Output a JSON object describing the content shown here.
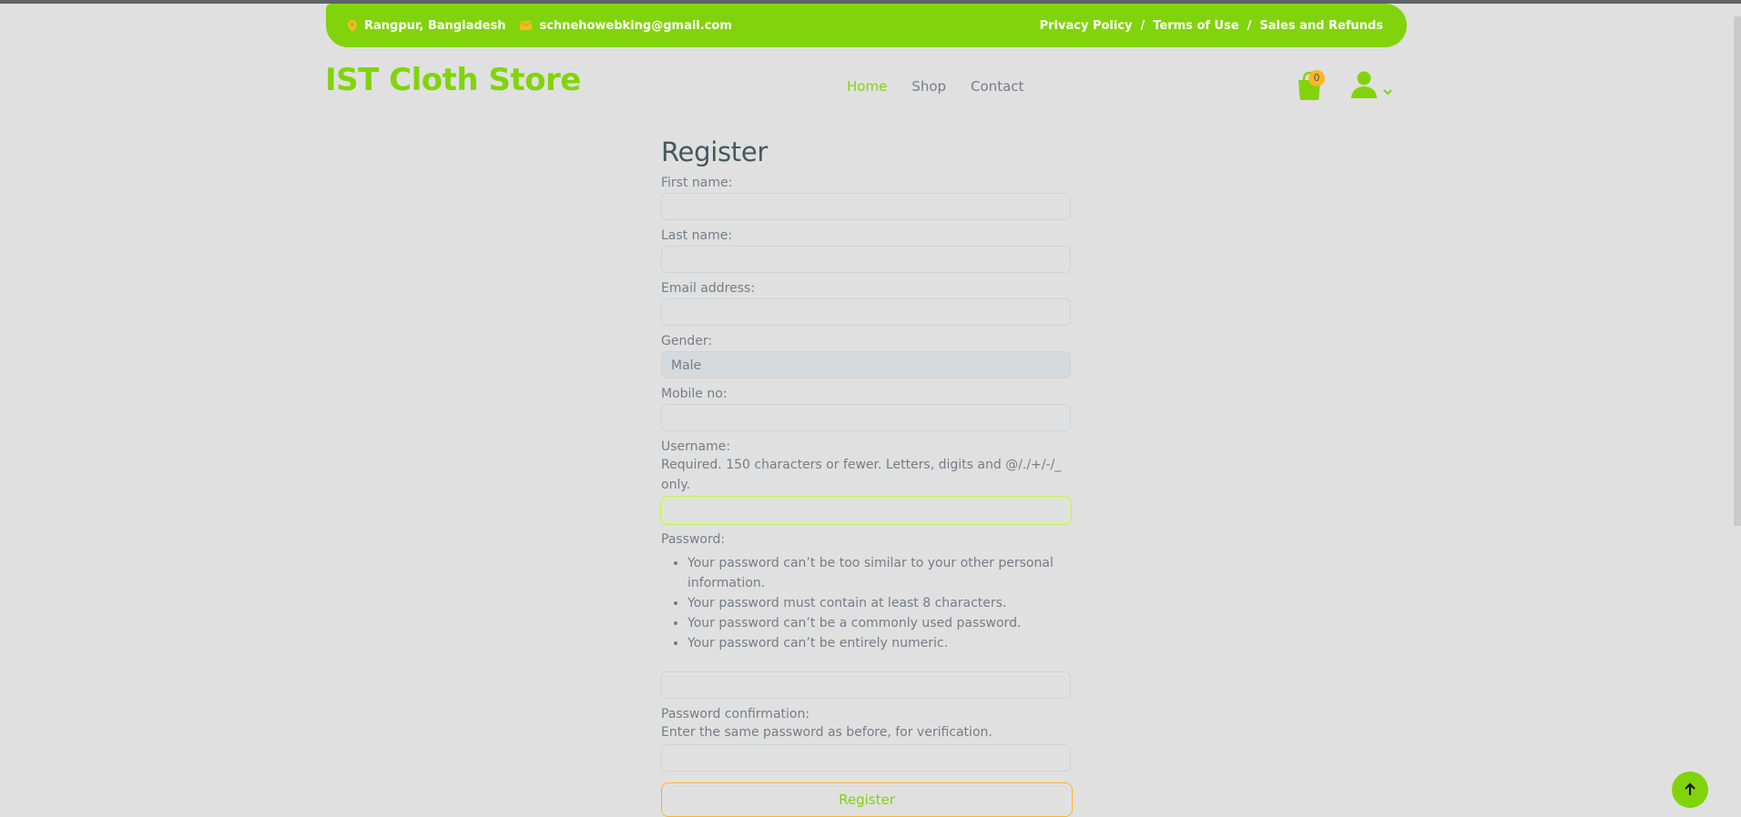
{
  "topbar": {
    "location": "Rangpur, Bangladesh",
    "email": "schnehowebking@gmail.com",
    "links": [
      "Privacy Policy",
      "Terms of Use",
      "Sales and Refunds"
    ],
    "separator": "/"
  },
  "brand": "IST Cloth Store",
  "nav": {
    "home": "Home",
    "shop": "Shop",
    "contact": "Contact"
  },
  "cart": {
    "count": "0"
  },
  "form": {
    "title": "Register",
    "first_name_label": "First name:",
    "last_name_label": "Last name:",
    "email_label": "Email address:",
    "gender_label": "Gender:",
    "gender_value": "Male",
    "mobile_label": "Mobile no:",
    "username_label": "Username:",
    "username_help": "Required. 150 characters or fewer. Letters, digits and @/./+/-/_ only.",
    "password_label": "Password:",
    "password_rules": [
      "Your password can’t be too similar to your other personal information.",
      "Your password must contain at least 8 characters.",
      "Your password can’t be a commonly used password.",
      "Your password can’t be entirely numeric."
    ],
    "password_confirm_label": "Password confirmation:",
    "password_confirm_help": "Enter the same password as before, for verification.",
    "submit_label": "Register"
  },
  "colors": {
    "primary": "#81d40b",
    "secondary": "#ffb524",
    "heading": "#45595b",
    "text": "#747d88",
    "background": "#e0e0e0"
  },
  "icons": {
    "location": "map-marker-icon",
    "email": "envelope-icon",
    "cart": "shopping-bag-icon",
    "user": "user-icon",
    "dropdown": "chevron-down-icon",
    "scroll_top": "arrow-up-icon"
  }
}
